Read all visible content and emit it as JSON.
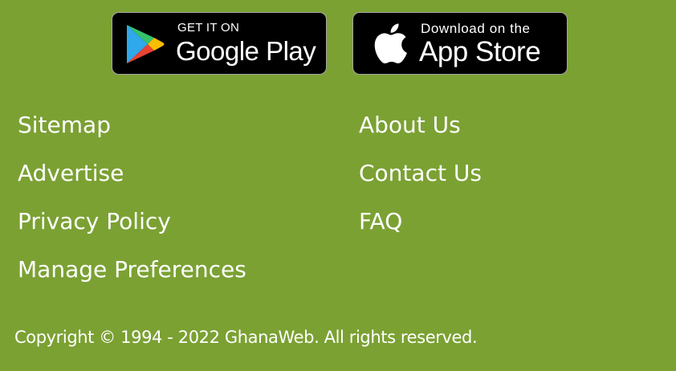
{
  "colors": {
    "background": "#7ba133",
    "text": "#ffffff",
    "badge_background": "#000000"
  },
  "app_badges": {
    "google_play": {
      "small_text": "GET IT ON",
      "big_text": "Google Play",
      "icon": "google-play-icon"
    },
    "app_store": {
      "small_text": "Download on the",
      "big_text": "App Store",
      "icon": "apple-icon"
    }
  },
  "footer_links": {
    "left": [
      "Sitemap",
      "Advertise",
      "Privacy Policy",
      "Manage Preferences"
    ],
    "right": [
      "About Us",
      "Contact Us",
      "FAQ"
    ]
  },
  "copyright": "Copyright © 1994 - 2022 GhanaWeb. All rights reserved."
}
